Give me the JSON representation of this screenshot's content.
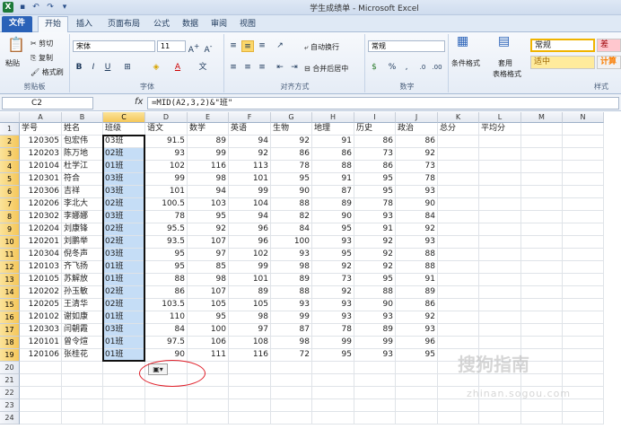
{
  "window": {
    "title": "学生成绩单 - Microsoft Excel"
  },
  "tabs": [
    "文件",
    "开始",
    "插入",
    "页面布局",
    "公式",
    "数据",
    "审阅",
    "视图"
  ],
  "ribbon": {
    "clipboard": {
      "label": "剪贴板",
      "paste": "粘贴",
      "cut": "剪切",
      "copy": "复制",
      "painter": "格式刷"
    },
    "font": {
      "label": "字体",
      "name": "宋体",
      "size": "11"
    },
    "alignment": {
      "label": "对齐方式",
      "wrap": "自动换行",
      "merge": "合并后居中"
    },
    "number": {
      "label": "数字",
      "format": "常规"
    },
    "styles": {
      "label": "样式",
      "cond": "条件格式",
      "table": "套用",
      "table2": "表格格式",
      "normal": "常规",
      "bad": "差",
      "neutral": "适中",
      "calc": "计算"
    }
  },
  "formula_bar": {
    "name_box": "C2",
    "fx": "fx",
    "formula": "=MID(A2,3,2)&\"班\""
  },
  "columns": [
    "A",
    "B",
    "C",
    "D",
    "E",
    "F",
    "G",
    "H",
    "I",
    "J",
    "K",
    "L",
    "M",
    "N"
  ],
  "headers": [
    "学号",
    "姓名",
    "班级",
    "语文",
    "数学",
    "英语",
    "生物",
    "地理",
    "历史",
    "政治",
    "总分",
    "平均分"
  ],
  "rows": [
    [
      "120305",
      "包宏伟",
      "03班",
      "91.5",
      "89",
      "94",
      "92",
      "91",
      "86",
      "86"
    ],
    [
      "120203",
      "陈万地",
      "02班",
      "93",
      "99",
      "92",
      "86",
      "86",
      "73",
      "92"
    ],
    [
      "120104",
      "杜学江",
      "01班",
      "102",
      "116",
      "113",
      "78",
      "88",
      "86",
      "73"
    ],
    [
      "120301",
      "符合",
      "03班",
      "99",
      "98",
      "101",
      "95",
      "91",
      "95",
      "78"
    ],
    [
      "120306",
      "吉祥",
      "03班",
      "101",
      "94",
      "99",
      "90",
      "87",
      "95",
      "93"
    ],
    [
      "120206",
      "李北大",
      "02班",
      "100.5",
      "103",
      "104",
      "88",
      "89",
      "78",
      "90"
    ],
    [
      "120302",
      "李娜娜",
      "03班",
      "78",
      "95",
      "94",
      "82",
      "90",
      "93",
      "84"
    ],
    [
      "120204",
      "刘康锋",
      "02班",
      "95.5",
      "92",
      "96",
      "84",
      "95",
      "91",
      "92"
    ],
    [
      "120201",
      "刘鹏举",
      "02班",
      "93.5",
      "107",
      "96",
      "100",
      "93",
      "92",
      "93"
    ],
    [
      "120304",
      "倪冬声",
      "03班",
      "95",
      "97",
      "102",
      "93",
      "95",
      "92",
      "88"
    ],
    [
      "120103",
      "齐飞扬",
      "01班",
      "95",
      "85",
      "99",
      "98",
      "92",
      "92",
      "88"
    ],
    [
      "120105",
      "苏解放",
      "01班",
      "88",
      "98",
      "101",
      "89",
      "73",
      "95",
      "91"
    ],
    [
      "120202",
      "孙玉敏",
      "02班",
      "86",
      "107",
      "89",
      "88",
      "92",
      "88",
      "89"
    ],
    [
      "120205",
      "王清华",
      "02班",
      "103.5",
      "105",
      "105",
      "93",
      "93",
      "90",
      "86"
    ],
    [
      "120102",
      "谢如康",
      "01班",
      "110",
      "95",
      "98",
      "99",
      "93",
      "93",
      "92"
    ],
    [
      "120303",
      "闫朝霞",
      "03班",
      "84",
      "100",
      "97",
      "87",
      "78",
      "89",
      "93"
    ],
    [
      "120101",
      "曾令煊",
      "01班",
      "97.5",
      "106",
      "108",
      "98",
      "99",
      "99",
      "96"
    ],
    [
      "120106",
      "张桂花",
      "01班",
      "90",
      "111",
      "116",
      "72",
      "95",
      "93",
      "95"
    ]
  ],
  "row_numbers": [
    "1",
    "2",
    "3",
    "4",
    "5",
    "6",
    "7",
    "8",
    "9",
    "10",
    "11",
    "12",
    "13",
    "14",
    "15",
    "16",
    "17",
    "18",
    "19",
    "20",
    "21",
    "22",
    "23",
    "24"
  ],
  "watermark": {
    "main": "搜狗指南",
    "sub": "zhinan.sogou.com"
  }
}
